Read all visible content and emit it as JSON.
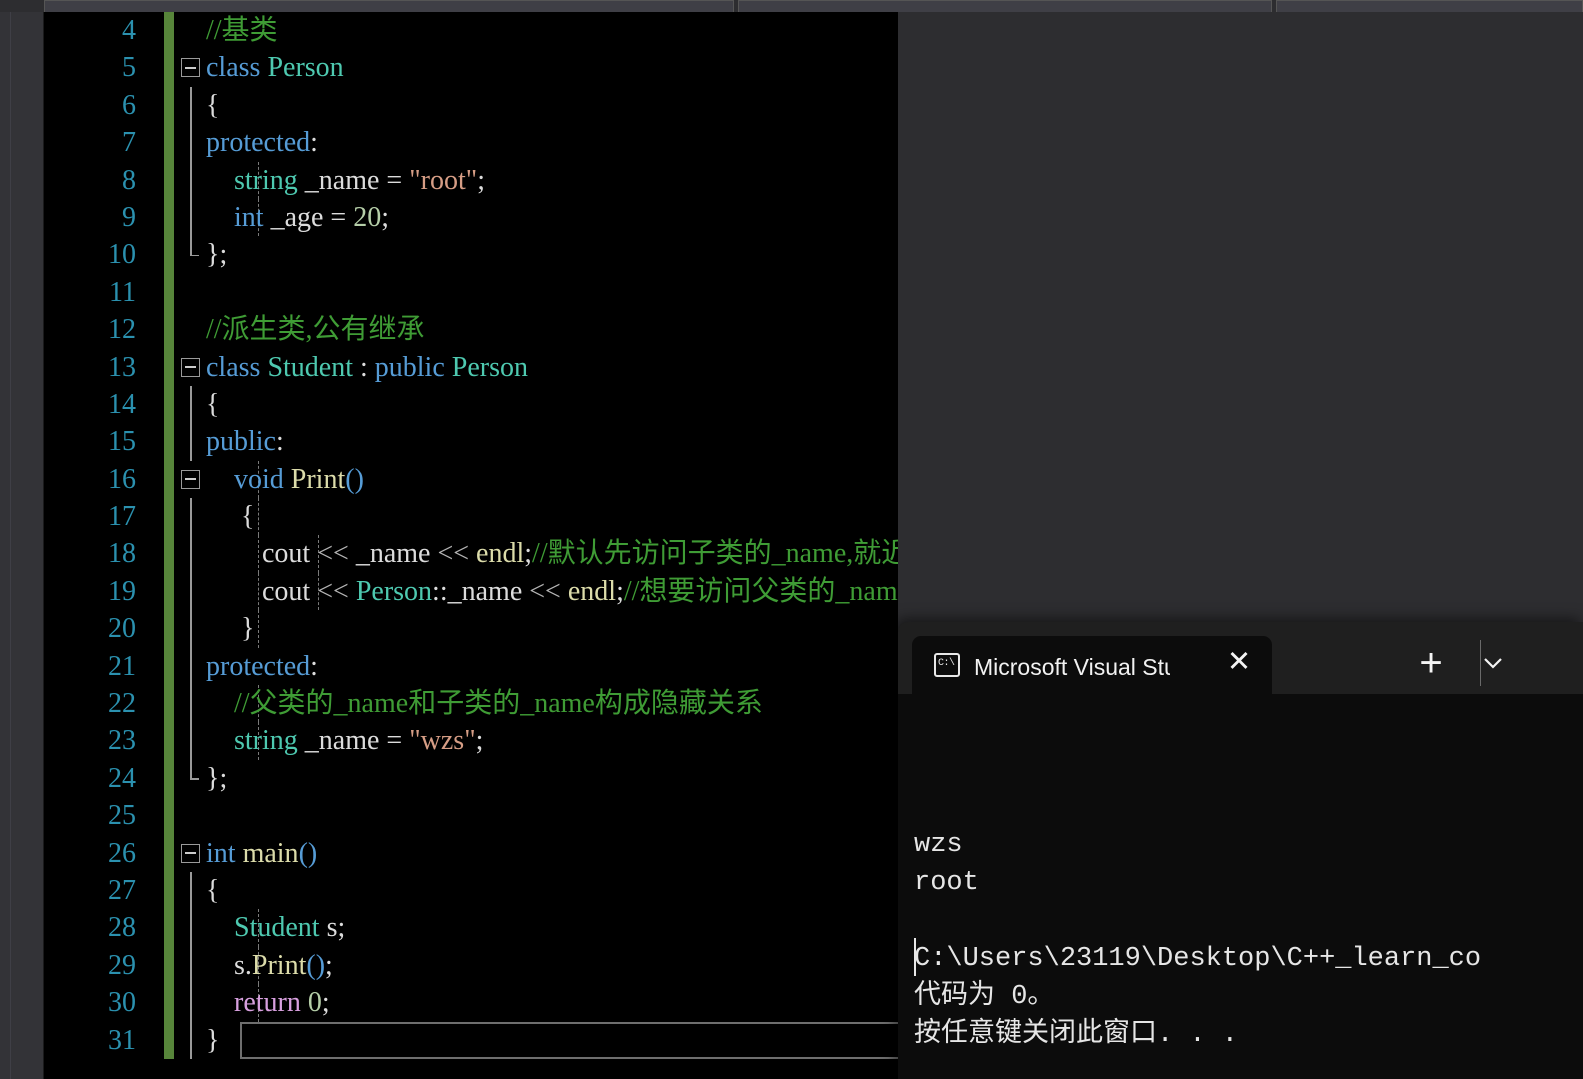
{
  "app": {
    "name": "Microsoft Visual Studio",
    "theme": "dark",
    "colors": {
      "editor_background": "#000000",
      "line_number": "#2b91af",
      "change_bar_saved": "#57853a",
      "keyword": "#569cd6",
      "type": "#4ec9b0",
      "comment": "#3f9c35",
      "string": "#d69d85",
      "number": "#b5cea8",
      "function": "#dcdcaa",
      "control_keyword": "#d8a0df",
      "plain_text": "#dcdcdc",
      "terminal_background": "#0c0c0c",
      "terminal_chrome": "#1f1f1f"
    }
  },
  "editor": {
    "language": "C++",
    "first_visible_line": 4,
    "current_line": 31,
    "lines": [
      {
        "n": 4,
        "fold": "none",
        "guide": null,
        "tokens": [
          {
            "t": "//基类",
            "c": "cm"
          }
        ]
      },
      {
        "n": 5,
        "fold": "minus",
        "guide": null,
        "tokens": [
          {
            "t": "class ",
            "c": "kw"
          },
          {
            "t": "Person",
            "c": "type"
          }
        ]
      },
      {
        "n": 6,
        "fold": "line",
        "guide": null,
        "tokens": [
          {
            "t": "{",
            "c": "pl"
          }
        ]
      },
      {
        "n": 7,
        "fold": "line",
        "guide": null,
        "tokens": [
          {
            "t": "protected",
            "c": "kw"
          },
          {
            "t": ":",
            "c": "pl"
          }
        ]
      },
      {
        "n": 8,
        "fold": "line",
        "guide": 52,
        "tokens": [
          {
            "t": "    ",
            "c": "pl"
          },
          {
            "t": "string",
            "c": "type"
          },
          {
            "t": " _name = ",
            "c": "pl"
          },
          {
            "t": "\"root\"",
            "c": "str"
          },
          {
            "t": ";",
            "c": "pl"
          }
        ]
      },
      {
        "n": 9,
        "fold": "line",
        "guide": 52,
        "tokens": [
          {
            "t": "    ",
            "c": "pl"
          },
          {
            "t": "int",
            "c": "kw"
          },
          {
            "t": " _age = ",
            "c": "pl"
          },
          {
            "t": "20",
            "c": "num"
          },
          {
            "t": ";",
            "c": "pl"
          }
        ]
      },
      {
        "n": 10,
        "fold": "end",
        "guide": null,
        "tokens": [
          {
            "t": "};",
            "c": "pl"
          }
        ]
      },
      {
        "n": 11,
        "fold": "none",
        "guide": null,
        "tokens": [
          {
            "t": "",
            "c": "pl"
          }
        ]
      },
      {
        "n": 12,
        "fold": "none",
        "guide": null,
        "tokens": [
          {
            "t": "//派生类,公有继承",
            "c": "cm"
          }
        ]
      },
      {
        "n": 13,
        "fold": "minus",
        "guide": null,
        "tokens": [
          {
            "t": "class ",
            "c": "kw"
          },
          {
            "t": "Student",
            "c": "type"
          },
          {
            "t": " : ",
            "c": "pl"
          },
          {
            "t": "public",
            "c": "kw"
          },
          {
            "t": " ",
            "c": "pl"
          },
          {
            "t": "Person",
            "c": "type"
          }
        ]
      },
      {
        "n": 14,
        "fold": "line",
        "guide": null,
        "tokens": [
          {
            "t": "{",
            "c": "pl"
          }
        ]
      },
      {
        "n": 15,
        "fold": "line",
        "guide": null,
        "tokens": [
          {
            "t": "public",
            "c": "kw"
          },
          {
            "t": ":",
            "c": "pl"
          }
        ]
      },
      {
        "n": 16,
        "fold": "minus-line",
        "guide": 52,
        "tokens": [
          {
            "t": "    ",
            "c": "pl"
          },
          {
            "t": "void",
            "c": "kw"
          },
          {
            "t": " ",
            "c": "pl"
          },
          {
            "t": "Print",
            "c": "fn"
          },
          {
            "t": "()",
            "c": "kw"
          }
        ]
      },
      {
        "n": 17,
        "fold": "line",
        "guide": 52,
        "tokens": [
          {
            "t": "     {",
            "c": "pl"
          }
        ]
      },
      {
        "n": 18,
        "fold": "line",
        "guide": 52,
        "guide2": 112,
        "tokens": [
          {
            "t": "        ",
            "c": "pl"
          },
          {
            "t": "cout",
            "c": "pl"
          },
          {
            "t": " ",
            "c": "pl"
          },
          {
            "t": "<<",
            "c": "op"
          },
          {
            "t": " _name ",
            "c": "pl"
          },
          {
            "t": "<<",
            "c": "op"
          },
          {
            "t": " ",
            "c": "pl"
          },
          {
            "t": "endl",
            "c": "fn"
          },
          {
            "t": ";",
            "c": "pl"
          },
          {
            "t": "//默认先访问子类的_name,就近原则",
            "c": "cm"
          }
        ]
      },
      {
        "n": 19,
        "fold": "line",
        "guide": 52,
        "guide2": 112,
        "tokens": [
          {
            "t": "        ",
            "c": "pl"
          },
          {
            "t": "cout",
            "c": "pl"
          },
          {
            "t": " ",
            "c": "pl"
          },
          {
            "t": "<<",
            "c": "op"
          },
          {
            "t": " ",
            "c": "pl"
          },
          {
            "t": "Person",
            "c": "type"
          },
          {
            "t": "::_name ",
            "c": "pl"
          },
          {
            "t": "<<",
            "c": "op"
          },
          {
            "t": " ",
            "c": "pl"
          },
          {
            "t": "endl",
            "c": "fn"
          },
          {
            "t": ";",
            "c": "pl"
          },
          {
            "t": "//想要访问父类的_name,需要指定作用域",
            "c": "cm"
          }
        ]
      },
      {
        "n": 20,
        "fold": "line",
        "guide": 52,
        "tokens": [
          {
            "t": "     }",
            "c": "pl"
          }
        ]
      },
      {
        "n": 21,
        "fold": "line",
        "guide": null,
        "tokens": [
          {
            "t": "protected",
            "c": "kw"
          },
          {
            "t": ":",
            "c": "pl"
          }
        ]
      },
      {
        "n": 22,
        "fold": "line",
        "guide": 52,
        "tokens": [
          {
            "t": "    ",
            "c": "pl"
          },
          {
            "t": "//父类的_name和子类的_name构成隐藏关系",
            "c": "cm"
          }
        ]
      },
      {
        "n": 23,
        "fold": "line",
        "guide": 52,
        "tokens": [
          {
            "t": "    ",
            "c": "pl"
          },
          {
            "t": "string",
            "c": "type"
          },
          {
            "t": " _name = ",
            "c": "pl"
          },
          {
            "t": "\"wzs\"",
            "c": "str"
          },
          {
            "t": ";",
            "c": "pl"
          }
        ]
      },
      {
        "n": 24,
        "fold": "end",
        "guide": null,
        "tokens": [
          {
            "t": "};",
            "c": "pl"
          }
        ]
      },
      {
        "n": 25,
        "fold": "none",
        "guide": null,
        "tokens": [
          {
            "t": "",
            "c": "pl"
          }
        ]
      },
      {
        "n": 26,
        "fold": "minus",
        "guide": null,
        "tokens": [
          {
            "t": "int",
            "c": "kw"
          },
          {
            "t": " ",
            "c": "pl"
          },
          {
            "t": "main",
            "c": "fn"
          },
          {
            "t": "()",
            "c": "kw"
          }
        ]
      },
      {
        "n": 27,
        "fold": "line",
        "guide": null,
        "tokens": [
          {
            "t": "{",
            "c": "pl"
          }
        ]
      },
      {
        "n": 28,
        "fold": "line",
        "guide": 52,
        "tokens": [
          {
            "t": "    ",
            "c": "pl"
          },
          {
            "t": "Student",
            "c": "type"
          },
          {
            "t": " s;",
            "c": "pl"
          }
        ]
      },
      {
        "n": 29,
        "fold": "line",
        "guide": 52,
        "tokens": [
          {
            "t": "    ",
            "c": "pl"
          },
          {
            "t": "s.",
            "c": "pl"
          },
          {
            "t": "Print",
            "c": "fn"
          },
          {
            "t": "()",
            "c": "kw"
          },
          {
            "t": ";",
            "c": "pl"
          }
        ]
      },
      {
        "n": 30,
        "fold": "line",
        "guide": 52,
        "tokens": [
          {
            "t": "    ",
            "c": "pl"
          },
          {
            "t": "return",
            "c": "ctl"
          },
          {
            "t": " ",
            "c": "pl"
          },
          {
            "t": "0",
            "c": "num"
          },
          {
            "t": ";",
            "c": "pl"
          }
        ]
      },
      {
        "n": 31,
        "fold": "line",
        "guide": null,
        "current": true,
        "tokens": [
          {
            "t": "}",
            "c": "pl"
          }
        ]
      }
    ]
  },
  "terminal": {
    "tab_title": "Microsoft Visual Studio 调试挖",
    "tab_icon": "console-cmd-icon",
    "close_label": "✕",
    "newtab_label": "+",
    "dropdown_label": "⌄",
    "output_lines": [
      "wzs",
      "root",
      "",
      "C:\\Users\\23119\\Desktop\\C++_learn_co",
      "代码为 0。",
      "按任意键关闭此窗口. . ."
    ]
  }
}
